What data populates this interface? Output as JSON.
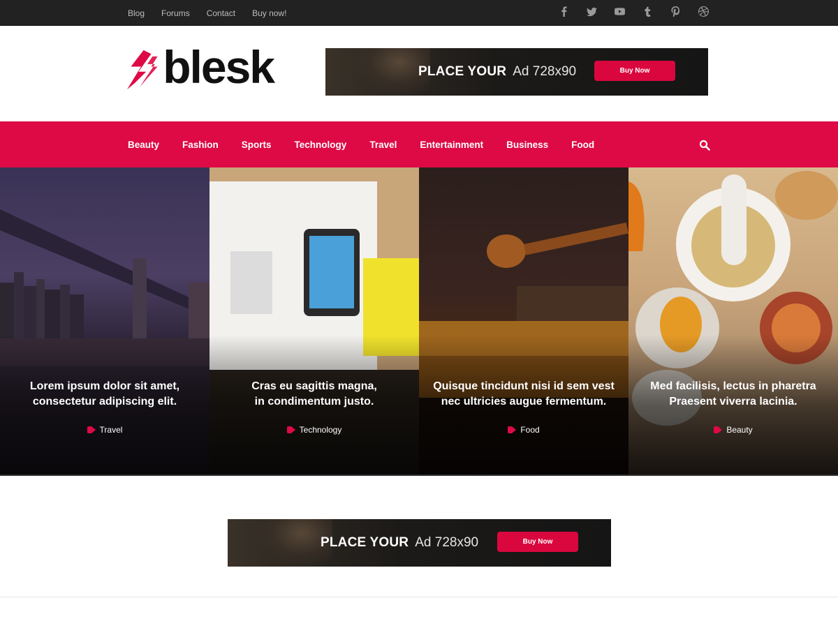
{
  "topbar": {
    "links": [
      "Blog",
      "Forums",
      "Contact",
      "Buy now!"
    ],
    "social": [
      "facebook-icon",
      "twitter-icon",
      "youtube-icon",
      "tumblr-icon",
      "pinterest-icon",
      "dribbble-icon"
    ]
  },
  "header": {
    "logo_text": "blesk",
    "ad": {
      "bold": "PLACE YOUR",
      "normal": "Ad 728x90",
      "button": "Buy Now"
    }
  },
  "nav": {
    "items": [
      "Beauty",
      "Fashion",
      "Sports",
      "Technology",
      "Travel",
      "Entertainment",
      "Business",
      "Food"
    ]
  },
  "featured": [
    {
      "title_line1": "Lorem ipsum dolor sit amet,",
      "title_line2": "consectetur adipiscing elit.",
      "category": "Travel"
    },
    {
      "title_line1": "Cras eu sagittis magna,",
      "title_line2": "in condimentum justo.",
      "category": "Technology"
    },
    {
      "title_line1": "Quisque tincidunt nisi id sem vest",
      "title_line2": "nec ultricies augue fermentum.",
      "category": "Food"
    },
    {
      "title_line1": "Med facilisis, lectus in pharetra",
      "title_line2": "Praesent viverra lacinia.",
      "category": "Beauty"
    }
  ],
  "ad_bottom": {
    "bold": "PLACE YOUR",
    "normal": "Ad 728x90",
    "button": "Buy Now"
  },
  "colors": {
    "accent": "#dd0a45",
    "topbar": "#222222"
  }
}
